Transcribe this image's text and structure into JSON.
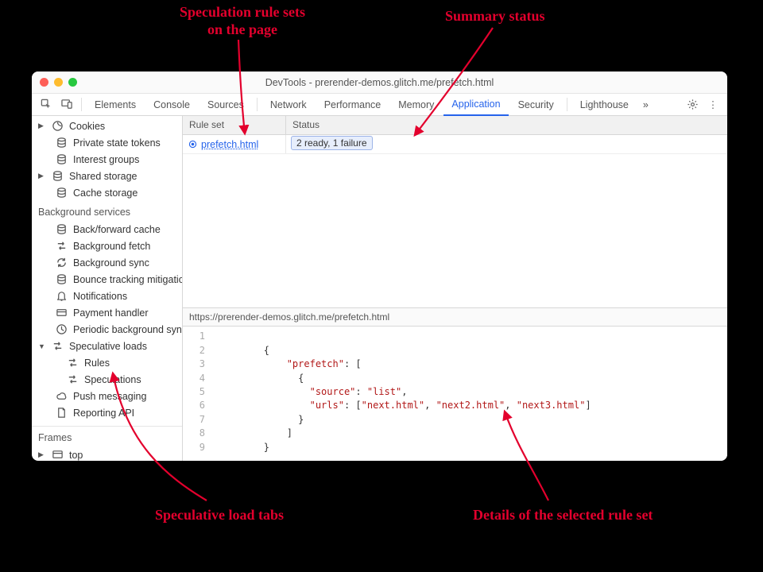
{
  "annotations": {
    "rule_sets": "Speculation rule sets\non the page",
    "summary_status": "Summary status",
    "load_tabs": "Speculative load tabs",
    "details": "Details of the selected rule set"
  },
  "window_title": "DevTools - prerender-demos.glitch.me/prefetch.html",
  "tabs": {
    "elements": "Elements",
    "console": "Console",
    "sources": "Sources",
    "network": "Network",
    "performance": "Performance",
    "memory": "Memory",
    "application": "Application",
    "security": "Security",
    "lighthouse": "Lighthouse"
  },
  "sidebar": {
    "cookies": "Cookies",
    "pst": "Private state tokens",
    "interest_groups": "Interest groups",
    "shared_storage": "Shared storage",
    "cache_storage": "Cache storage",
    "bg_services": "Background services",
    "bf_cache": "Back/forward cache",
    "bg_fetch": "Background fetch",
    "bg_sync": "Background sync",
    "bounce": "Bounce tracking mitigations",
    "notifications": "Notifications",
    "payment": "Payment handler",
    "periodic_sync": "Periodic background sync",
    "spec_loads": "Speculative loads",
    "rules": "Rules",
    "speculations": "Speculations",
    "push": "Push messaging",
    "reporting_api": "Reporting API",
    "frames": "Frames",
    "top": "top"
  },
  "grid": {
    "headers": {
      "rule": "Rule set",
      "status": "Status"
    },
    "rows": [
      {
        "rule": " prefetch.html",
        "status": "2 ready, 1 failure"
      }
    ]
  },
  "url": "https://prerender-demos.glitch.me/prefetch.html",
  "code_lines": [
    "1",
    "2",
    "3",
    "4",
    "5",
    "6",
    "7",
    "8",
    "9"
  ]
}
